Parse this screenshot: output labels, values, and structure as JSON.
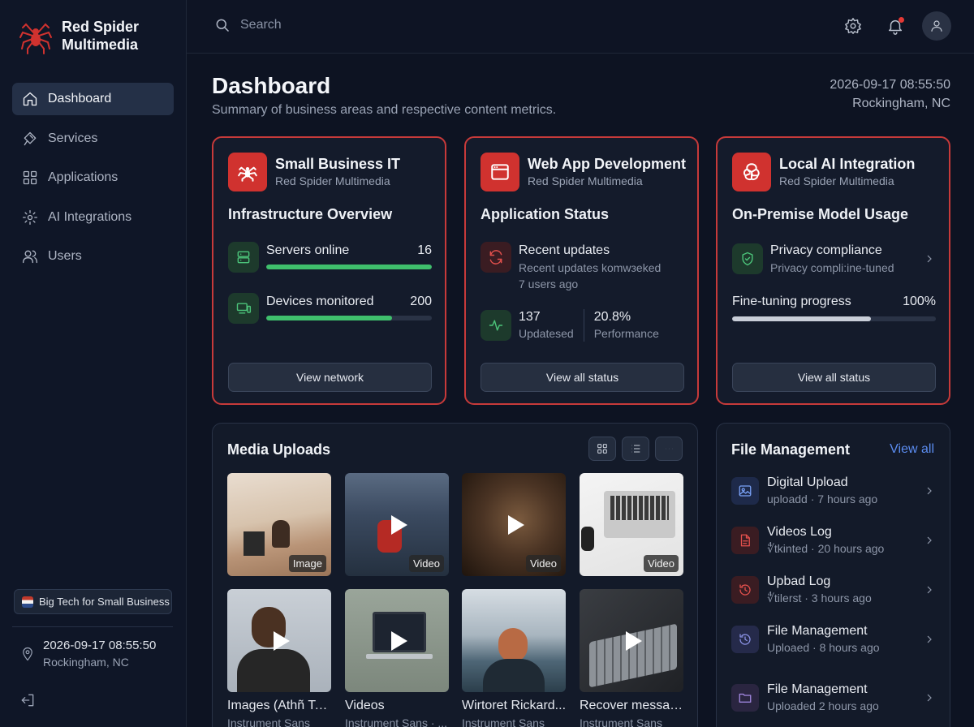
{
  "brand": {
    "name": "Red Spider Multimedia",
    "logo_icon": "spider-icon",
    "accent": "#d0322f"
  },
  "sidebar": {
    "items": [
      {
        "label": "Dashboard",
        "icon": "home-icon",
        "active": true
      },
      {
        "label": "Services",
        "icon": "services-icon",
        "active": false
      },
      {
        "label": "Applications",
        "icon": "grid-icon",
        "active": false
      },
      {
        "label": "AI Integrations",
        "icon": "gear-icon",
        "active": false
      },
      {
        "label": "Users",
        "icon": "users-icon",
        "active": false
      }
    ],
    "tagline": "Big Tech for Small Business",
    "datetime": "2026-09-17 08:55:50",
    "location": "Rockingham, NC"
  },
  "topbar": {
    "search_placeholder": "Search"
  },
  "header": {
    "title": "Dashboard",
    "subtitle": "Summary of business areas and respective content metrics.",
    "datetime": "2026-09-17 08:55:50",
    "location": "Rockingham, NC"
  },
  "cards": [
    {
      "title": "Small Business IT",
      "company": "Red Spider Multimedia",
      "section": "Infrastructure Overview",
      "metrics": [
        {
          "label": "Servers online",
          "value": "16",
          "progress": 1.0
        },
        {
          "label": "Devices monitored",
          "value": "200",
          "progress": 0.76
        }
      ],
      "button": "View network"
    },
    {
      "title": "Web App Development",
      "company": "Red Spider Multimedia",
      "section": "Application Status",
      "recent_title": "Recent updates",
      "recent_line1": "Recent updates komwзeked",
      "recent_line2": "7 users ago",
      "stat1_value": "137",
      "stat1_label": "Updatesed",
      "stat2_value": "20.8%",
      "stat2_label": "Performance",
      "button": "View all status"
    },
    {
      "title": "Local AI Integration",
      "company": "Red Spider Multimedia",
      "section": "On-Premise Model Usage",
      "privacy_title": "Privacy compliance",
      "privacy_sub": "Privacy compli:ine-tuned",
      "progress_label": "Fine-tuning progress",
      "progress_value": "100%",
      "progress": 0.68,
      "button": "View all status"
    }
  ],
  "media": {
    "title": "Media Uploads",
    "items": [
      {
        "badge": "Image",
        "caption": "",
        "sub": ""
      },
      {
        "badge": "Video",
        "caption": "",
        "sub": ""
      },
      {
        "badge": "Video",
        "caption": "",
        "sub": ""
      },
      {
        "badge": "Video",
        "caption": "",
        "sub": ""
      },
      {
        "badge": "",
        "caption": "Images (Athñ To...",
        "sub": "Instrument Sans"
      },
      {
        "badge": "",
        "caption": "Videos",
        "sub": "Instrument Sans · ..."
      },
      {
        "badge": "",
        "caption": "Wirtoret Rickard...",
        "sub": "Instrument Sans"
      },
      {
        "badge": "",
        "caption": "Recover messag...",
        "sub": "Instrument Sans"
      }
    ]
  },
  "files": {
    "title": "File Management",
    "view_all": "View all",
    "items": [
      {
        "name": "Digital Upload",
        "meta": "uploadd · 7 hours ago",
        "icon": "image-icon"
      },
      {
        "name": "Videos Log",
        "meta": "∜tkinted · 20 hours ago",
        "icon": "document-icon"
      },
      {
        "name": "Upbad Log",
        "meta": "∜tilerst · 3 hours ago",
        "icon": "history-icon"
      },
      {
        "name": "File Management",
        "meta": "Uploaed · 8 hours ago",
        "icon": "history-icon"
      },
      {
        "name": "File Management",
        "meta": "Uploaded 2 hours ago",
        "icon": "folder-icon"
      }
    ]
  }
}
